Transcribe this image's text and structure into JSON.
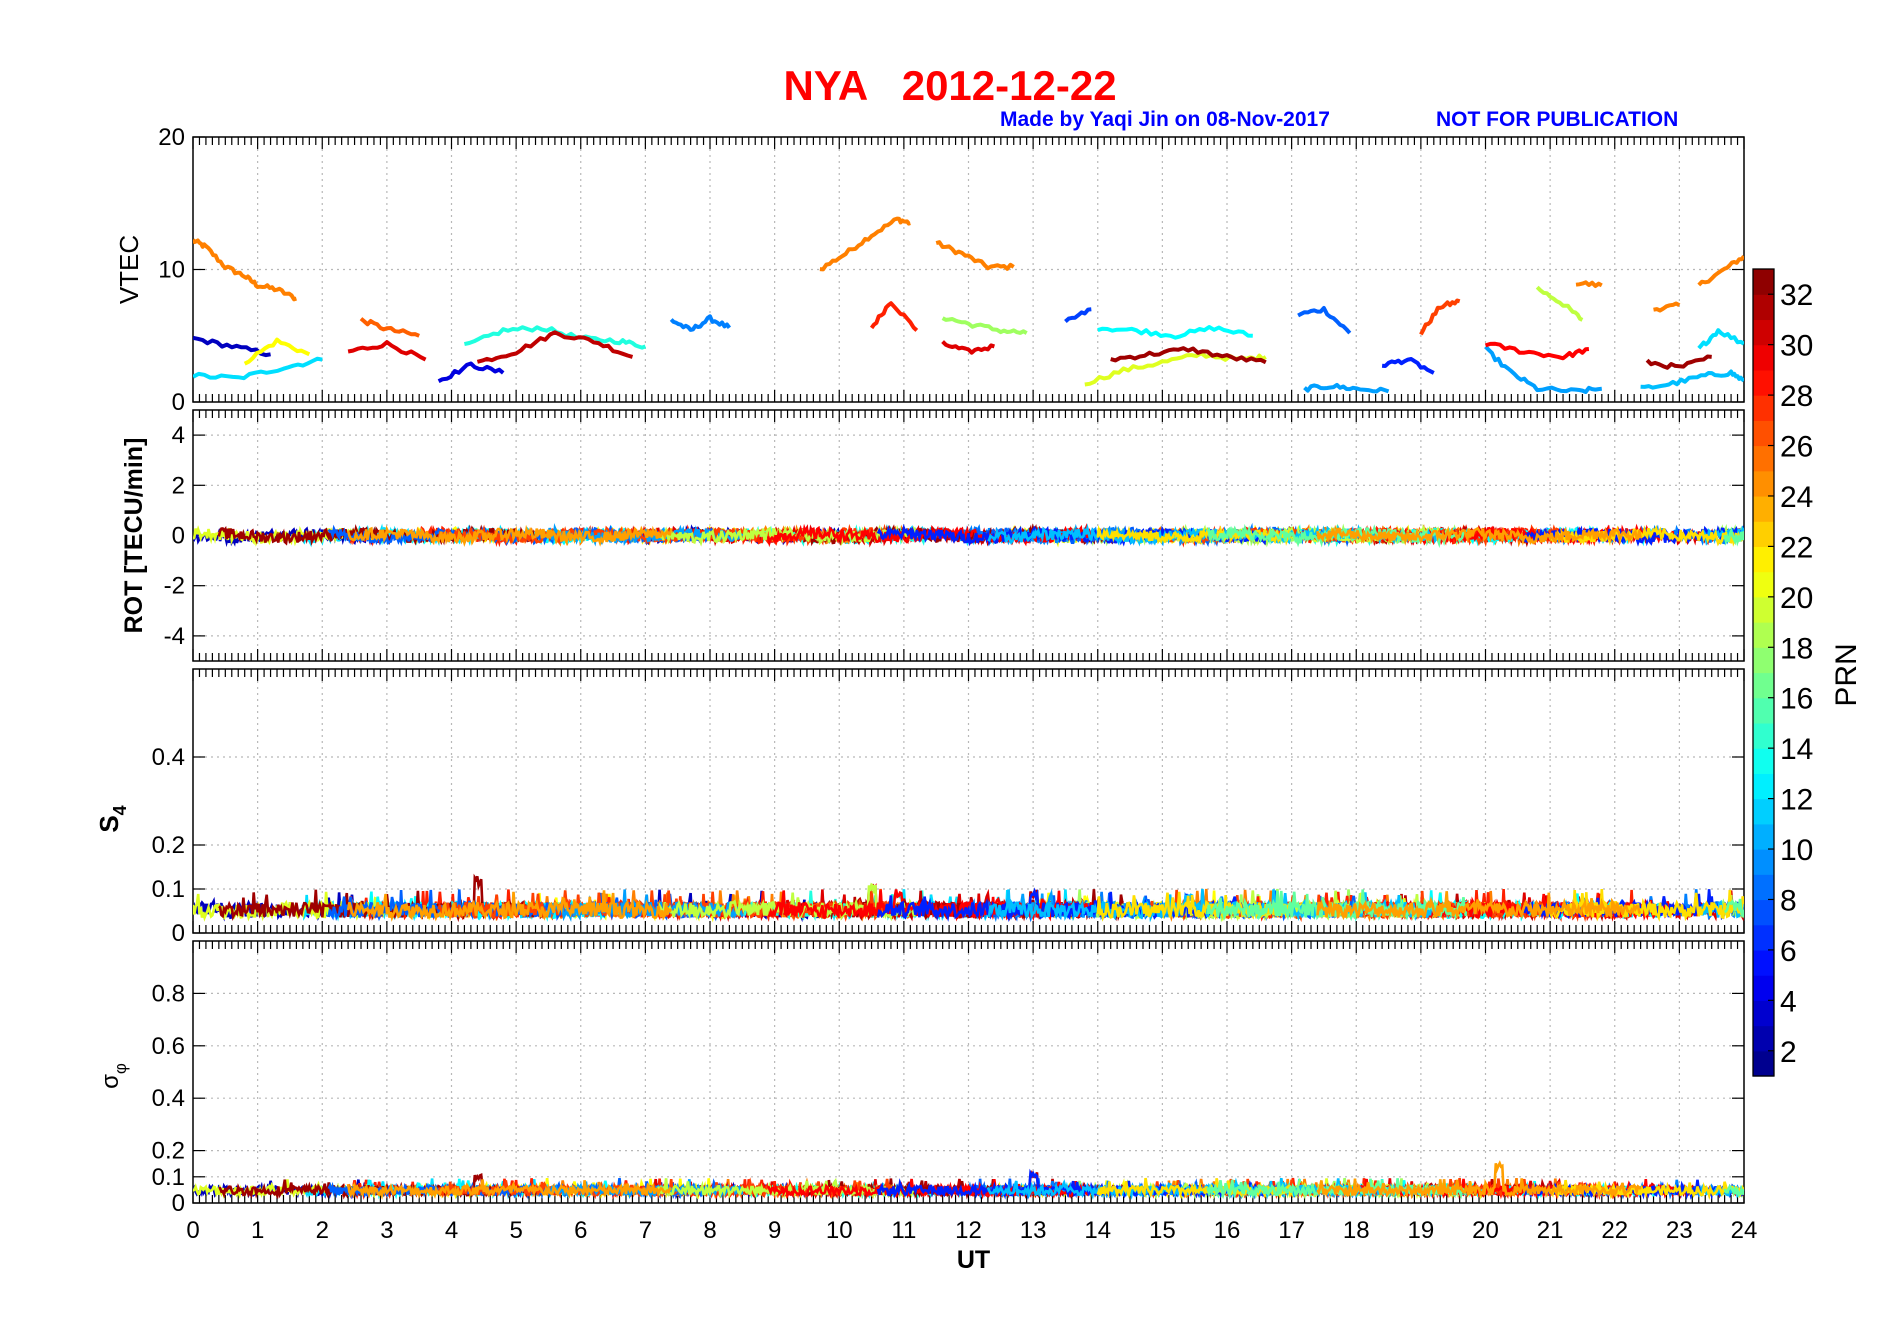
{
  "header": {
    "title": "NYA   2012-12-22",
    "credit": "Made by Yaqi Jin on 08-Nov-2017",
    "notice": "NOT FOR PUBLICATION"
  },
  "colors": {
    "title": "#ff0000",
    "credit": "#0000ff",
    "axes": "#000000",
    "grid": "#b8b8b8",
    "colormap": "jet"
  },
  "chart_data": [
    {
      "type": "line",
      "panel": "VTEC",
      "ylabel": "VTEC",
      "ylim": [
        0,
        20
      ],
      "yticks": [
        0,
        10,
        20
      ],
      "xlim": [
        0,
        24
      ],
      "grid": true,
      "series": [
        {
          "prn": 25,
          "x": [
            0.0,
            0.2,
            0.5,
            0.8,
            1.0,
            1.3,
            1.6
          ],
          "y": [
            12.2,
            11.7,
            10.2,
            9.5,
            8.8,
            8.5,
            7.8
          ]
        },
        {
          "prn": 25,
          "x": [
            9.7,
            10.1,
            10.5,
            10.9,
            11.1
          ],
          "y": [
            10.0,
            11.2,
            12.6,
            13.8,
            13.5
          ]
        },
        {
          "prn": 25,
          "x": [
            11.5,
            11.9,
            12.3,
            12.7
          ],
          "y": [
            12.0,
            11.2,
            10.2,
            10.2
          ]
        },
        {
          "prn": 25,
          "x": [
            21.4,
            21.8
          ],
          "y": [
            9.0,
            8.8
          ]
        },
        {
          "prn": 25,
          "x": [
            22.6,
            23.0
          ],
          "y": [
            7.0,
            7.3
          ]
        },
        {
          "prn": 25,
          "x": [
            23.3,
            23.7,
            24.0
          ],
          "y": [
            8.8,
            10.0,
            11.0
          ]
        },
        {
          "prn": 19,
          "x": [
            20.8,
            21.2,
            21.5
          ],
          "y": [
            8.6,
            7.4,
            6.2
          ]
        },
        {
          "prn": 28,
          "x": [
            10.5,
            10.8,
            11.2
          ],
          "y": [
            5.6,
            7.6,
            5.4
          ]
        },
        {
          "prn": 27,
          "x": [
            19.0,
            19.3,
            19.6
          ],
          "y": [
            5.2,
            7.2,
            7.6
          ]
        },
        {
          "prn": 8,
          "x": [
            17.1,
            17.5,
            17.9
          ],
          "y": [
            6.6,
            7.0,
            5.2
          ]
        },
        {
          "prn": 9,
          "x": [
            7.4,
            7.7,
            8.0,
            8.3
          ],
          "y": [
            6.2,
            5.4,
            6.3,
            5.6
          ]
        },
        {
          "prn": 7,
          "x": [
            13.5,
            13.9
          ],
          "y": [
            6.0,
            7.0
          ]
        },
        {
          "prn": 3,
          "x": [
            0.0,
            0.6,
            1.2
          ],
          "y": [
            4.8,
            4.2,
            3.6
          ]
        },
        {
          "prn": 12,
          "x": [
            0.0,
            0.7,
            1.4,
            2.0
          ],
          "y": [
            2.0,
            1.8,
            2.6,
            3.2
          ]
        },
        {
          "prn": 21,
          "x": [
            0.8,
            1.3,
            1.8
          ],
          "y": [
            3.0,
            4.6,
            3.6
          ]
        },
        {
          "prn": 26,
          "x": [
            2.6,
            3.0,
            3.5
          ],
          "y": [
            6.2,
            5.5,
            5.0
          ]
        },
        {
          "prn": 30,
          "x": [
            2.4,
            3.0,
            3.6
          ],
          "y": [
            3.8,
            4.4,
            3.2
          ]
        },
        {
          "prn": 14,
          "x": [
            4.2,
            4.8,
            5.4,
            6.0,
            6.6,
            7.0
          ],
          "y": [
            4.2,
            5.4,
            5.6,
            4.8,
            4.6,
            4.2
          ]
        },
        {
          "prn": 31,
          "x": [
            4.4,
            5.0,
            5.6,
            6.2,
            6.8
          ],
          "y": [
            3.0,
            3.8,
            5.2,
            4.6,
            3.4
          ]
        },
        {
          "prn": 4,
          "x": [
            3.8,
            4.3,
            4.8
          ],
          "y": [
            1.6,
            2.8,
            2.2
          ]
        },
        {
          "prn": 18,
          "x": [
            11.6,
            12.0,
            12.5,
            12.9
          ],
          "y": [
            6.4,
            5.9,
            5.4,
            5.2
          ]
        },
        {
          "prn": 30,
          "x": [
            11.6,
            12.0,
            12.4
          ],
          "y": [
            4.4,
            3.8,
            4.2
          ]
        },
        {
          "prn": 20,
          "x": [
            13.8,
            14.4,
            15.0,
            15.6,
            16.2,
            16.6
          ],
          "y": [
            1.4,
            2.4,
            3.0,
            3.6,
            3.2,
            3.4
          ]
        },
        {
          "prn": 13,
          "x": [
            14.0,
            14.6,
            15.2,
            15.8,
            16.4
          ],
          "y": [
            5.6,
            5.4,
            5.0,
            5.6,
            5.0
          ]
        },
        {
          "prn": 32,
          "x": [
            14.2,
            14.8,
            15.4,
            16.0,
            16.6
          ],
          "y": [
            3.2,
            3.6,
            4.0,
            3.4,
            3.0
          ]
        },
        {
          "prn": 10,
          "x": [
            17.2,
            17.6,
            18.0,
            18.5
          ],
          "y": [
            1.0,
            1.2,
            1.0,
            0.8
          ]
        },
        {
          "prn": 6,
          "x": [
            18.4,
            18.8,
            19.2
          ],
          "y": [
            2.8,
            3.2,
            2.2
          ]
        },
        {
          "prn": 10,
          "x": [
            20.0,
            20.4,
            20.8,
            21.4,
            21.8
          ],
          "y": [
            4.0,
            2.2,
            1.0,
            0.8,
            1.0
          ]
        },
        {
          "prn": 29,
          "x": [
            20.0,
            20.6,
            21.2,
            21.6
          ],
          "y": [
            4.4,
            3.8,
            3.4,
            4.0
          ]
        },
        {
          "prn": 11,
          "x": [
            22.4,
            22.9,
            23.4,
            23.8,
            24.0
          ],
          "y": [
            1.0,
            1.4,
            2.0,
            2.2,
            1.6
          ]
        },
        {
          "prn": 32,
          "x": [
            22.5,
            23.0,
            23.5
          ],
          "y": [
            3.0,
            2.6,
            3.4
          ]
        },
        {
          "prn": 12,
          "x": [
            23.3,
            23.6,
            24.0
          ],
          "y": [
            4.0,
            5.4,
            4.4
          ]
        }
      ]
    },
    {
      "type": "line",
      "panel": "ROT",
      "ylabel": "ROT [TECU/min]",
      "ylim": [
        -5,
        5
      ],
      "yticks": [
        -4,
        -2,
        0,
        2,
        4
      ],
      "xlim": [
        0,
        24
      ],
      "grid": true,
      "summary": "All PRNs fluctuate near 0 TECU/min, spread about ±0.5"
    },
    {
      "type": "line",
      "panel": "S4",
      "ylabel": "S4",
      "ylim": [
        0,
        0.6
      ],
      "yticks": [
        0,
        0.1,
        0.2,
        0.4
      ],
      "xlim": [
        0,
        24
      ],
      "grid": true,
      "summary": "Background ~0.02–0.08 with spikes to ~0.13 near 4.4 UT and ~0.11 near 10–11 UT and 13 UT"
    },
    {
      "type": "line",
      "panel": "SigmaPhi",
      "ylabel": "σφ",
      "ylim": [
        0,
        1
      ],
      "yticks": [
        0,
        0.1,
        0.2,
        0.4,
        0.6,
        0.8
      ],
      "xlim": [
        0,
        24
      ],
      "xticks": [
        0,
        1,
        2,
        3,
        4,
        5,
        6,
        7,
        8,
        9,
        10,
        11,
        12,
        13,
        14,
        15,
        16,
        17,
        18,
        19,
        20,
        21,
        22,
        23,
        24
      ],
      "xlabel": "UT",
      "grid": true,
      "summary": "Background ~0.02–0.07 with peaks ~0.12 near 13 UT and ~0.16 near 20.2 UT"
    },
    {
      "type": "colorbar",
      "label": "PRN",
      "range": [
        1,
        33
      ],
      "ticks": [
        2,
        4,
        6,
        8,
        10,
        12,
        14,
        16,
        18,
        20,
        22,
        24,
        26,
        28,
        30,
        32
      ],
      "colormap": "jet"
    }
  ]
}
